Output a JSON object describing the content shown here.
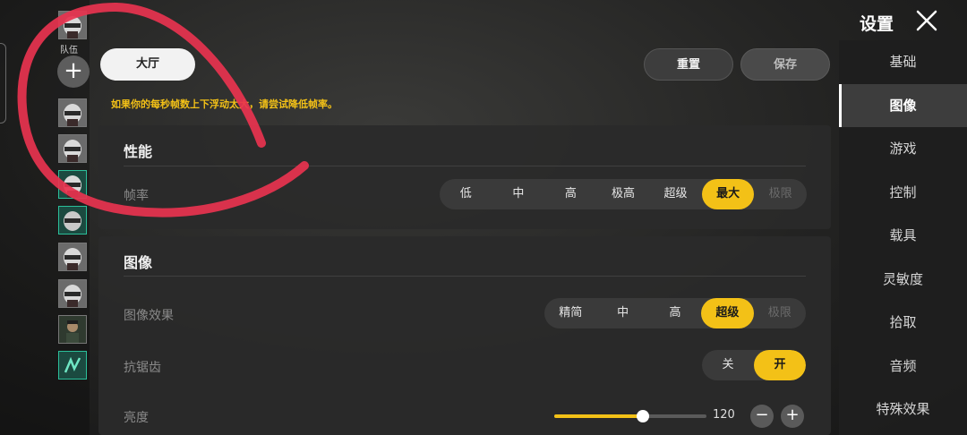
{
  "squad": {
    "label": "队伍",
    "add_symbol": "+",
    "members": [
      {
        "icon": "helmet-avatar-icon",
        "style": "grey"
      },
      {
        "icon": "helmet-avatar-icon",
        "style": "grey"
      },
      {
        "icon": "helmet-avatar-icon",
        "style": "grey"
      },
      {
        "icon": "helmet-avatar-icon",
        "style": "green"
      },
      {
        "icon": "helmet-avatar-icon",
        "style": "green"
      },
      {
        "icon": "helmet-avatar-icon",
        "style": "grey"
      },
      {
        "icon": "helmet-avatar-icon",
        "style": "grey"
      },
      {
        "icon": "character-avatar-icon",
        "style": "grey"
      },
      {
        "icon": "signal-avatar-icon",
        "style": "green"
      }
    ]
  },
  "toolbar": {
    "lobby_label": "大厅",
    "reset_label": "重置",
    "save_label": "保存"
  },
  "notice": "如果你的每秒帧数上下浮动太大，请尝试降低帧率。",
  "performance": {
    "title": "性能",
    "frame_rate": {
      "label": "帧率",
      "options": [
        "低",
        "中",
        "高",
        "极高",
        "超级",
        "最大",
        "极限"
      ],
      "selected": "最大"
    }
  },
  "graphics": {
    "title": "图像",
    "quality": {
      "label": "图像效果",
      "options": [
        "精简",
        "中",
        "高",
        "超级",
        "极限"
      ],
      "selected": "超级"
    },
    "anti_aliasing": {
      "label": "抗锯齿",
      "options": [
        "关",
        "开"
      ],
      "selected": "开"
    },
    "brightness": {
      "label": "亮度",
      "value": "120",
      "level": 0.58,
      "minus": "−",
      "plus": "+"
    }
  },
  "sidebar": {
    "title": "设置",
    "items": [
      {
        "label": "基础"
      },
      {
        "label": "图像",
        "active": true
      },
      {
        "label": "游戏"
      },
      {
        "label": "控制"
      },
      {
        "label": "载具"
      },
      {
        "label": "灵敏度"
      },
      {
        "label": "拾取"
      },
      {
        "label": "音频"
      },
      {
        "label": "特殊效果"
      }
    ]
  },
  "colors": {
    "accent": "#f3c117",
    "annotation": "#e8334f",
    "teammate_green": "#2bbf9a"
  }
}
